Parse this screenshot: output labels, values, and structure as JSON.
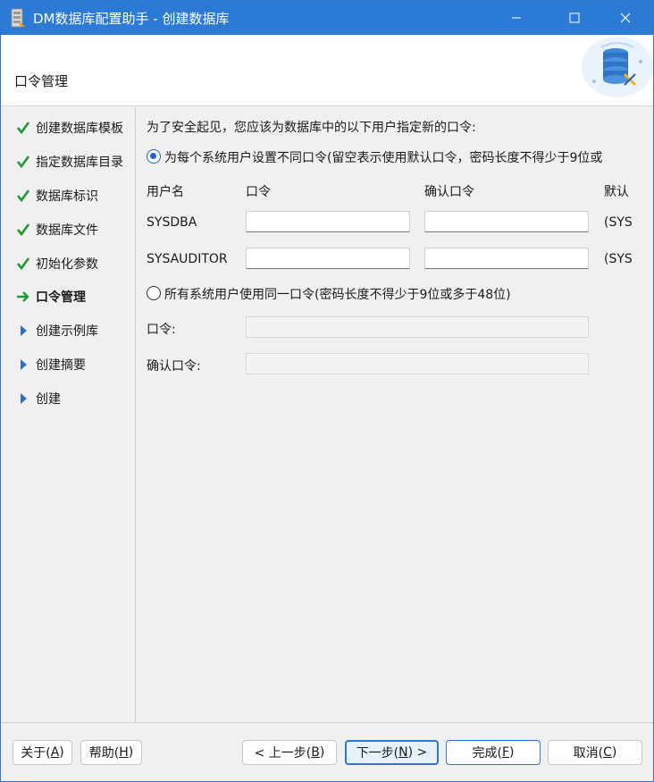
{
  "window": {
    "title": "DM数据库配置助手 - 创建数据库"
  },
  "header": {
    "title": "口令管理"
  },
  "nav": {
    "items": [
      {
        "label": "创建数据库模板",
        "state": "done"
      },
      {
        "label": "指定数据库目录",
        "state": "done"
      },
      {
        "label": "数据库标识",
        "state": "done"
      },
      {
        "label": "数据库文件",
        "state": "done"
      },
      {
        "label": "初始化参数",
        "state": "done"
      },
      {
        "label": "口令管理",
        "state": "current"
      },
      {
        "label": "创建示例库",
        "state": "pending"
      },
      {
        "label": "创建摘要",
        "state": "pending"
      },
      {
        "label": "创建",
        "state": "pending"
      }
    ]
  },
  "main": {
    "intro": "为了安全起见，您应该为数据库中的以下用户指定新的口令:",
    "option_separate": {
      "label": "为每个系统用户设置不同口令(留空表示使用默认口令，密码长度不得少于9位或",
      "selected": true
    },
    "columns": {
      "user": "用户名",
      "password": "口令",
      "confirm": "确认口令",
      "default": "默认"
    },
    "users": [
      {
        "name": "SYSDBA",
        "password": "",
        "confirm": "",
        "default": "(SYS"
      },
      {
        "name": "SYSAUDITOR",
        "password": "",
        "confirm": "",
        "default": "(SYS"
      }
    ],
    "option_same": {
      "label": "所有系统用户使用同一口令(密码长度不得少于9位或多于48位)",
      "selected": false
    },
    "same_password_label": "口令:",
    "same_confirm_label": "确认口令:",
    "same_password_value": "",
    "same_confirm_value": ""
  },
  "footer": {
    "about": {
      "text": "关于(",
      "key": "A",
      "end": ")"
    },
    "help": {
      "text": "帮助(",
      "key": "H",
      "end": ")"
    },
    "back": {
      "text": "< 上一步(",
      "key": "B",
      "end": ")"
    },
    "next": {
      "text": "下一步(",
      "key": "N",
      "end": ") >"
    },
    "finish": {
      "text": "完成(",
      "key": "F",
      "end": ")"
    },
    "cancel": {
      "text": "取消(",
      "key": "C",
      "end": ")"
    }
  },
  "colors": {
    "titlebar": "#2b7bd6",
    "check": "#1f9a2e",
    "arrow_current": "#1f9a2e",
    "arrow_pending": "#2a6fc4"
  }
}
